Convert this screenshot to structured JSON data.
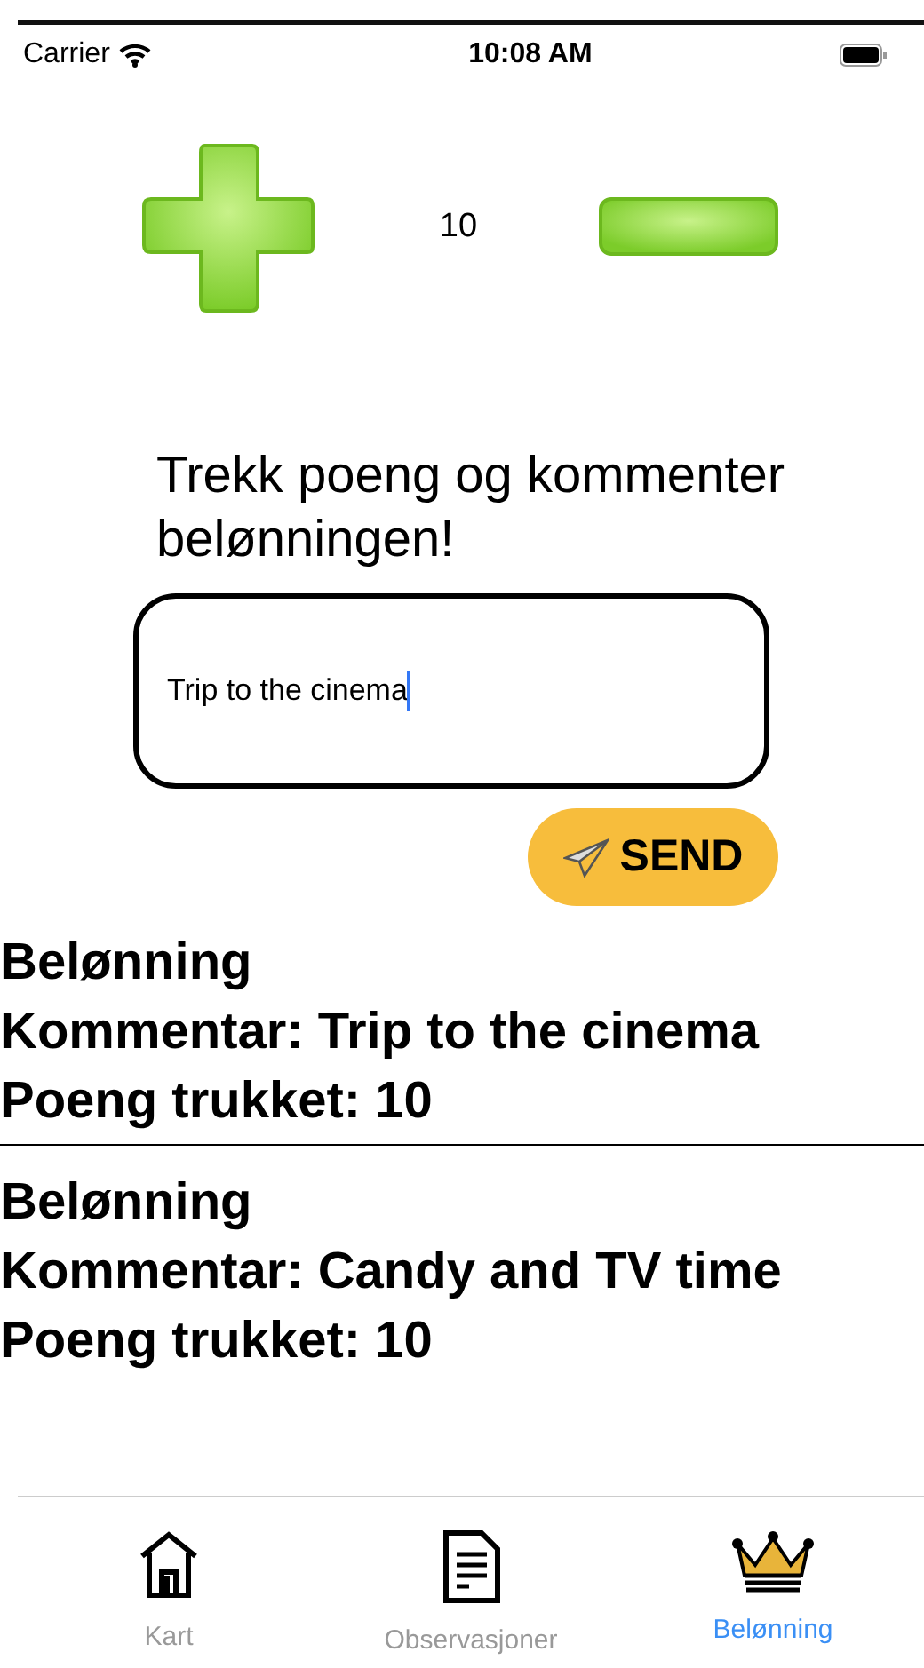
{
  "status_bar": {
    "carrier": "Carrier",
    "time": "10:08 AM"
  },
  "counter": {
    "value": "10"
  },
  "prompt": "Trekk poeng og kommenter belønningen!",
  "comment_field": {
    "value": "Trip to the cinema",
    "focused": true
  },
  "send_button": {
    "label": "SEND"
  },
  "entries": [
    {
      "title": "Belønning",
      "comment": "Kommentar:  Trip to the cinema",
      "points": "Poeng trukket: 10"
    },
    {
      "title": "Belønning",
      "comment": "Kommentar:  Candy and TV time",
      "points": "Poeng trukket: 10"
    }
  ],
  "tabs": [
    {
      "label": "Kart",
      "kind": "house",
      "selected": false
    },
    {
      "label": "Observasjoner",
      "kind": "document",
      "selected": false
    },
    {
      "label": "Belønning",
      "kind": "crown",
      "selected": true
    }
  ]
}
